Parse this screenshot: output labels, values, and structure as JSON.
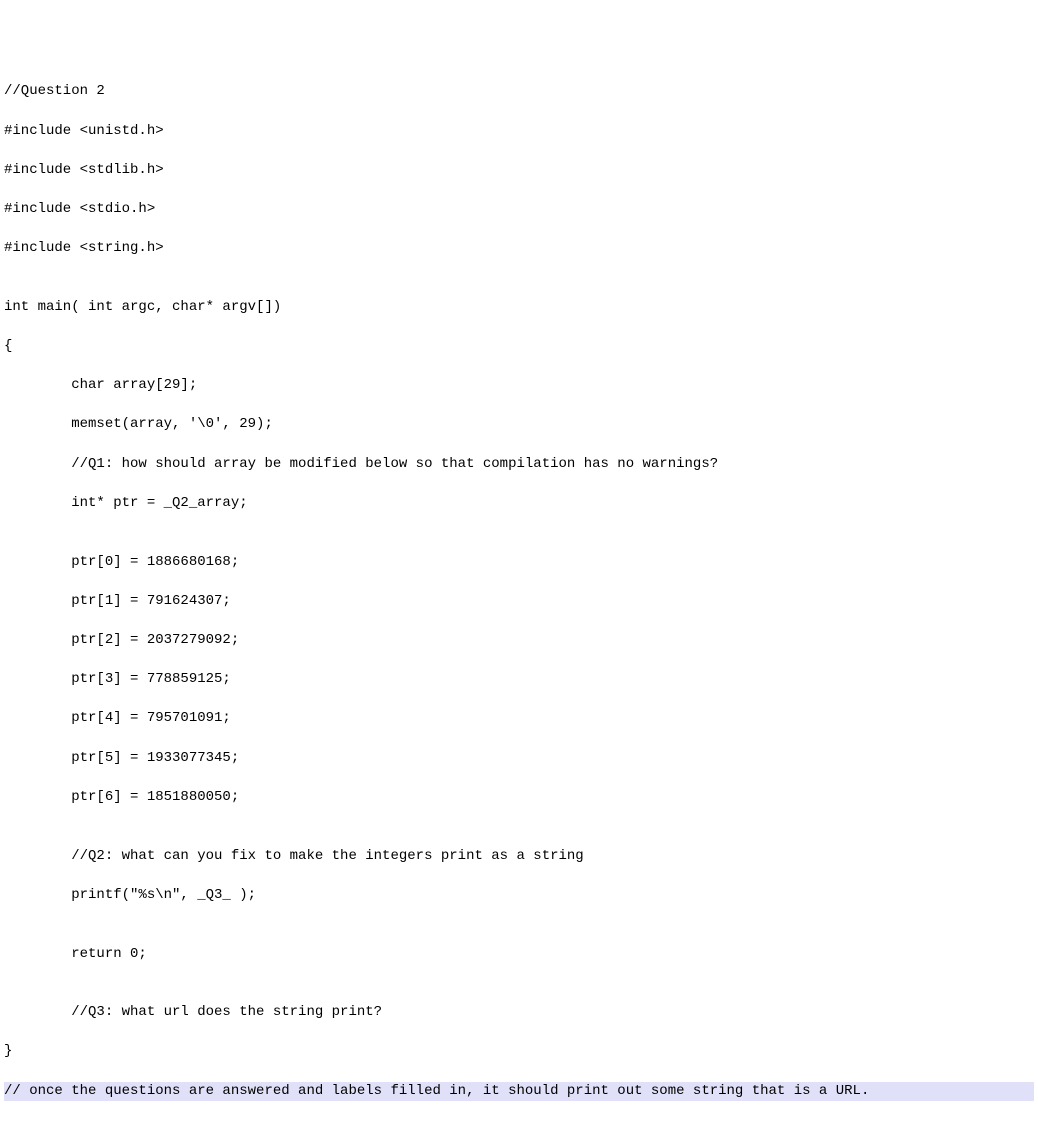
{
  "code": {
    "line1": "//Question 2",
    "line2": "#include <unistd.h>",
    "line3": "#include <stdlib.h>",
    "line4": "#include <stdio.h>",
    "line5": "#include <string.h>",
    "line6": "",
    "line7": "int main( int argc, char* argv[])",
    "line8": "{",
    "line9": "        char array[29];",
    "line10": "        memset(array, '\\0', 29);",
    "line11": "        //Q1: how should array be modified below so that compilation has no warnings?",
    "line12": "        int* ptr = _Q2_array;",
    "line13": "",
    "line14": "        ptr[0] = 1886680168;",
    "line15": "        ptr[1] = 791624307;",
    "line16": "        ptr[2] = 2037279092;",
    "line17": "        ptr[3] = 778859125;",
    "line18": "        ptr[4] = 795701091;",
    "line19": "        ptr[5] = 1933077345;",
    "line20": "        ptr[6] = 1851880050;",
    "line21": "",
    "line22": "        //Q2: what can you fix to make the integers print as a string",
    "line23": "        printf(\"%s\\n\", _Q3_ );",
    "line24": "",
    "line25": "        return 0;",
    "line26": "",
    "line27": "        //Q3: what url does the string print?",
    "line28": "}",
    "line29": "// once the questions are answered and labels filled in, it should print out some string that is a URL."
  }
}
